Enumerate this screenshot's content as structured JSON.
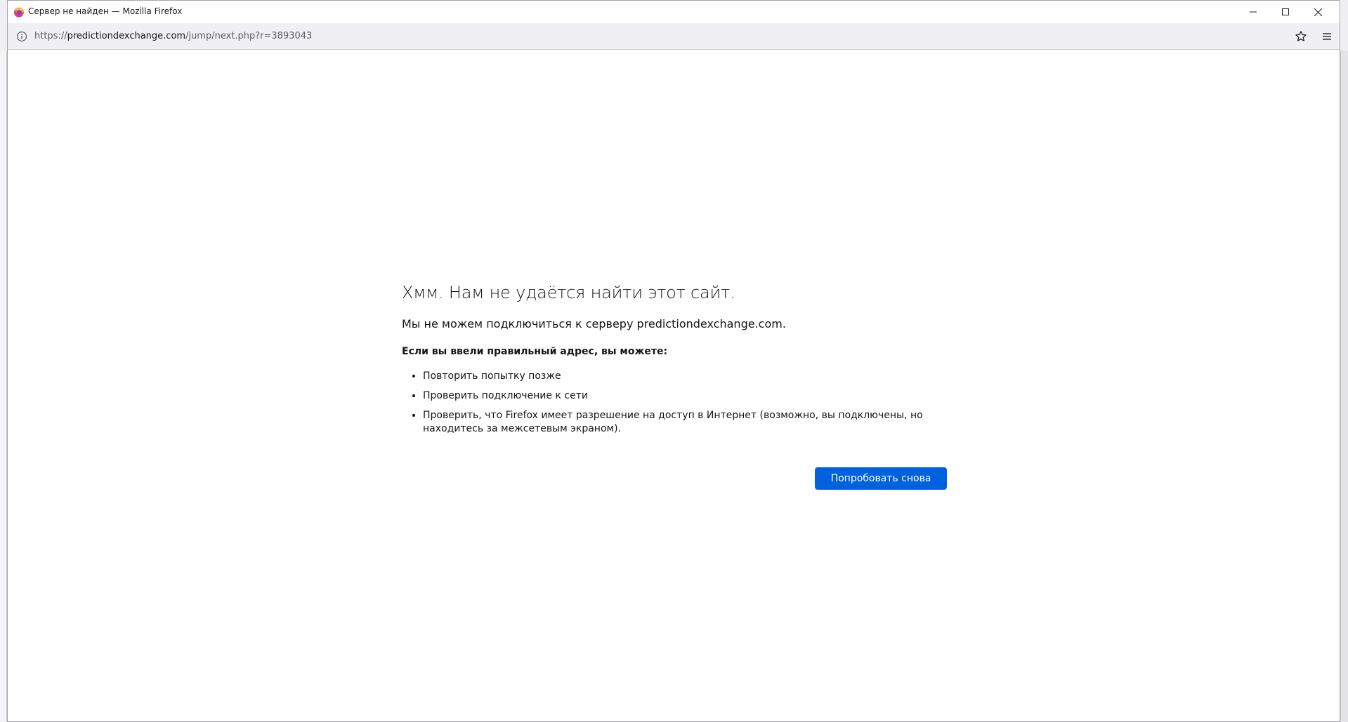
{
  "window": {
    "title": "Сервер не найден — Mozilla Firefox"
  },
  "urlbar": {
    "scheme": "https://",
    "domain": "predictiondexchange.com",
    "path": "/jump/next.php?r=3893043"
  },
  "icons": {
    "logo": "firefox-logo-icon",
    "info": "info-icon",
    "bookmark": "star-icon",
    "menu": "hamburger-menu-icon",
    "minimize": "minimize-icon",
    "maximize": "maximize-icon",
    "close": "close-icon"
  },
  "error": {
    "title": "Хмм. Нам не удаётся найти этот сайт.",
    "description": "Мы не можем подключиться к серверу predictiondexchange.com.",
    "hint": "Если вы ввели правильный адрес, вы можете:",
    "suggestions": [
      "Повторить попытку позже",
      "Проверить подключение к сети",
      "Проверить, что Firefox имеет разрешение на доступ в Интернет (возможно, вы подключены, но находитесь за межсетевым экраном)."
    ],
    "retry_label": "Попробовать снова"
  },
  "colors": {
    "accent": "#0061e0",
    "text": "#15141a",
    "toolbar": "#f0f0f4"
  }
}
